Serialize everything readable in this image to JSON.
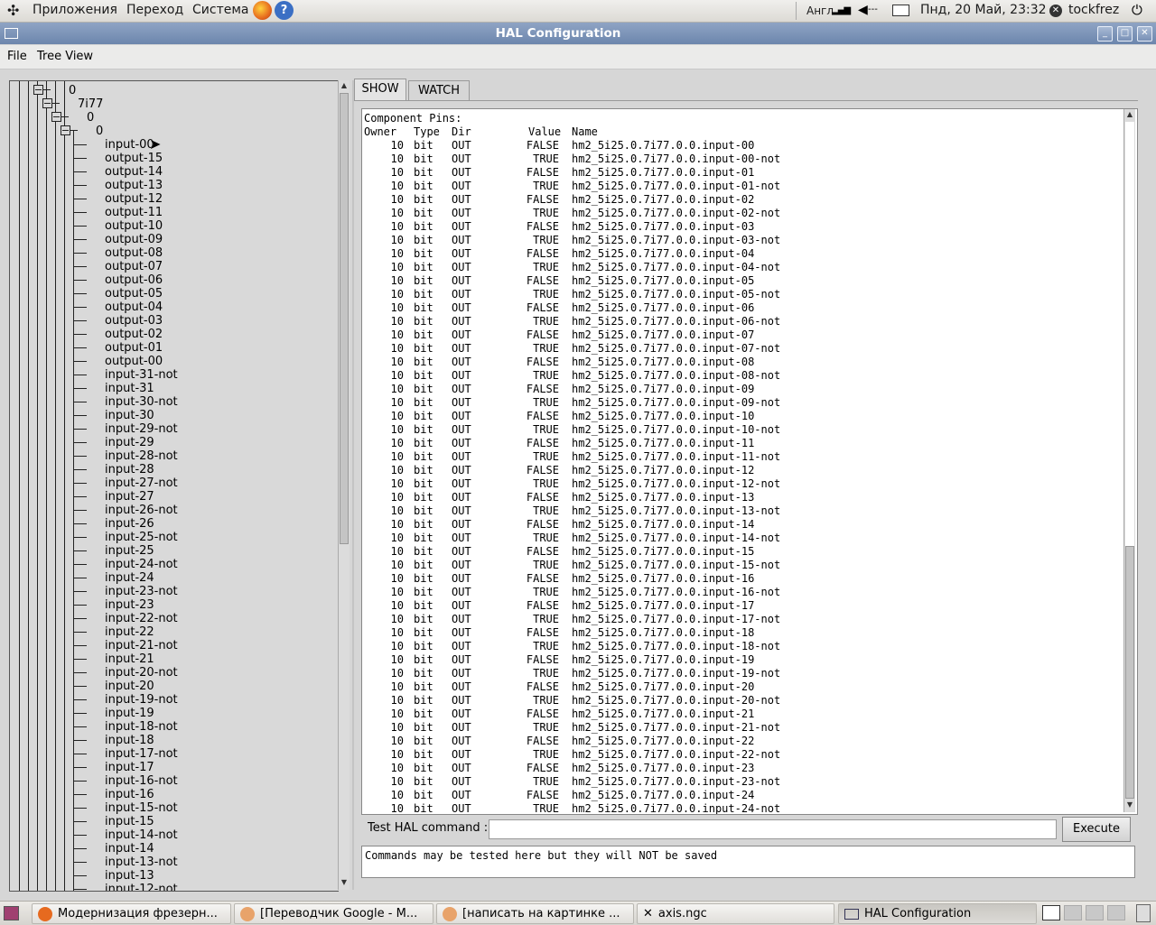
{
  "top_panel": {
    "applications": "Приложения",
    "places": "Переход",
    "system": "Система",
    "keyboard_layout": "Англ",
    "datetime": "Пнд, 20 Май, 23:32",
    "user": "tockfrez"
  },
  "window": {
    "title": "HAL Configuration"
  },
  "menubar": {
    "file": "File",
    "tree_view": "Tree View"
  },
  "tree": {
    "root_node": "0",
    "card_node": "7i77",
    "sub_node": "0",
    "sub_sub_node": "0",
    "items": [
      "input-00",
      "output-15",
      "output-14",
      "output-13",
      "output-12",
      "output-11",
      "output-10",
      "output-09",
      "output-08",
      "output-07",
      "output-06",
      "output-05",
      "output-04",
      "output-03",
      "output-02",
      "output-01",
      "output-00",
      "input-31-not",
      "input-31",
      "input-30-not",
      "input-30",
      "input-29-not",
      "input-29",
      "input-28-not",
      "input-28",
      "input-27-not",
      "input-27",
      "input-26-not",
      "input-26",
      "input-25-not",
      "input-25",
      "input-24-not",
      "input-24",
      "input-23-not",
      "input-23",
      "input-22-not",
      "input-22",
      "input-21-not",
      "input-21",
      "input-20-not",
      "input-20",
      "input-19-not",
      "input-19",
      "input-18-not",
      "input-18",
      "input-17-not",
      "input-17",
      "input-16-not",
      "input-16",
      "input-15-not",
      "input-15",
      "input-14-not",
      "input-14",
      "input-13-not",
      "input-13",
      "input-12-not"
    ]
  },
  "tabs": {
    "show": "SHOW",
    "watch": "WATCH"
  },
  "show": {
    "heading": "Component Pins:",
    "columns": [
      "Owner",
      "Type",
      "Dir",
      "Value",
      "Name"
    ],
    "rows": [
      [
        "10",
        "bit",
        "OUT",
        "FALSE",
        "hm2_5i25.0.7i77.0.0.input-00"
      ],
      [
        "10",
        "bit",
        "OUT",
        "TRUE",
        "hm2_5i25.0.7i77.0.0.input-00-not"
      ],
      [
        "10",
        "bit",
        "OUT",
        "FALSE",
        "hm2_5i25.0.7i77.0.0.input-01"
      ],
      [
        "10",
        "bit",
        "OUT",
        "TRUE",
        "hm2_5i25.0.7i77.0.0.input-01-not"
      ],
      [
        "10",
        "bit",
        "OUT",
        "FALSE",
        "hm2_5i25.0.7i77.0.0.input-02"
      ],
      [
        "10",
        "bit",
        "OUT",
        "TRUE",
        "hm2_5i25.0.7i77.0.0.input-02-not"
      ],
      [
        "10",
        "bit",
        "OUT",
        "FALSE",
        "hm2_5i25.0.7i77.0.0.input-03"
      ],
      [
        "10",
        "bit",
        "OUT",
        "TRUE",
        "hm2_5i25.0.7i77.0.0.input-03-not"
      ],
      [
        "10",
        "bit",
        "OUT",
        "FALSE",
        "hm2_5i25.0.7i77.0.0.input-04"
      ],
      [
        "10",
        "bit",
        "OUT",
        "TRUE",
        "hm2_5i25.0.7i77.0.0.input-04-not"
      ],
      [
        "10",
        "bit",
        "OUT",
        "FALSE",
        "hm2_5i25.0.7i77.0.0.input-05"
      ],
      [
        "10",
        "bit",
        "OUT",
        "TRUE",
        "hm2_5i25.0.7i77.0.0.input-05-not"
      ],
      [
        "10",
        "bit",
        "OUT",
        "FALSE",
        "hm2_5i25.0.7i77.0.0.input-06"
      ],
      [
        "10",
        "bit",
        "OUT",
        "TRUE",
        "hm2_5i25.0.7i77.0.0.input-06-not"
      ],
      [
        "10",
        "bit",
        "OUT",
        "FALSE",
        "hm2_5i25.0.7i77.0.0.input-07"
      ],
      [
        "10",
        "bit",
        "OUT",
        "TRUE",
        "hm2_5i25.0.7i77.0.0.input-07-not"
      ],
      [
        "10",
        "bit",
        "OUT",
        "FALSE",
        "hm2_5i25.0.7i77.0.0.input-08"
      ],
      [
        "10",
        "bit",
        "OUT",
        "TRUE",
        "hm2_5i25.0.7i77.0.0.input-08-not"
      ],
      [
        "10",
        "bit",
        "OUT",
        "FALSE",
        "hm2_5i25.0.7i77.0.0.input-09"
      ],
      [
        "10",
        "bit",
        "OUT",
        "TRUE",
        "hm2_5i25.0.7i77.0.0.input-09-not"
      ],
      [
        "10",
        "bit",
        "OUT",
        "FALSE",
        "hm2_5i25.0.7i77.0.0.input-10"
      ],
      [
        "10",
        "bit",
        "OUT",
        "TRUE",
        "hm2_5i25.0.7i77.0.0.input-10-not"
      ],
      [
        "10",
        "bit",
        "OUT",
        "FALSE",
        "hm2_5i25.0.7i77.0.0.input-11"
      ],
      [
        "10",
        "bit",
        "OUT",
        "TRUE",
        "hm2_5i25.0.7i77.0.0.input-11-not"
      ],
      [
        "10",
        "bit",
        "OUT",
        "FALSE",
        "hm2_5i25.0.7i77.0.0.input-12"
      ],
      [
        "10",
        "bit",
        "OUT",
        "TRUE",
        "hm2_5i25.0.7i77.0.0.input-12-not"
      ],
      [
        "10",
        "bit",
        "OUT",
        "FALSE",
        "hm2_5i25.0.7i77.0.0.input-13"
      ],
      [
        "10",
        "bit",
        "OUT",
        "TRUE",
        "hm2_5i25.0.7i77.0.0.input-13-not"
      ],
      [
        "10",
        "bit",
        "OUT",
        "FALSE",
        "hm2_5i25.0.7i77.0.0.input-14"
      ],
      [
        "10",
        "bit",
        "OUT",
        "TRUE",
        "hm2_5i25.0.7i77.0.0.input-14-not"
      ],
      [
        "10",
        "bit",
        "OUT",
        "FALSE",
        "hm2_5i25.0.7i77.0.0.input-15"
      ],
      [
        "10",
        "bit",
        "OUT",
        "TRUE",
        "hm2_5i25.0.7i77.0.0.input-15-not"
      ],
      [
        "10",
        "bit",
        "OUT",
        "FALSE",
        "hm2_5i25.0.7i77.0.0.input-16"
      ],
      [
        "10",
        "bit",
        "OUT",
        "TRUE",
        "hm2_5i25.0.7i77.0.0.input-16-not"
      ],
      [
        "10",
        "bit",
        "OUT",
        "FALSE",
        "hm2_5i25.0.7i77.0.0.input-17"
      ],
      [
        "10",
        "bit",
        "OUT",
        "TRUE",
        "hm2_5i25.0.7i77.0.0.input-17-not"
      ],
      [
        "10",
        "bit",
        "OUT",
        "FALSE",
        "hm2_5i25.0.7i77.0.0.input-18"
      ],
      [
        "10",
        "bit",
        "OUT",
        "TRUE",
        "hm2_5i25.0.7i77.0.0.input-18-not"
      ],
      [
        "10",
        "bit",
        "OUT",
        "FALSE",
        "hm2_5i25.0.7i77.0.0.input-19"
      ],
      [
        "10",
        "bit",
        "OUT",
        "TRUE",
        "hm2_5i25.0.7i77.0.0.input-19-not"
      ],
      [
        "10",
        "bit",
        "OUT",
        "FALSE",
        "hm2_5i25.0.7i77.0.0.input-20"
      ],
      [
        "10",
        "bit",
        "OUT",
        "TRUE",
        "hm2_5i25.0.7i77.0.0.input-20-not"
      ],
      [
        "10",
        "bit",
        "OUT",
        "FALSE",
        "hm2_5i25.0.7i77.0.0.input-21"
      ],
      [
        "10",
        "bit",
        "OUT",
        "TRUE",
        "hm2_5i25.0.7i77.0.0.input-21-not"
      ],
      [
        "10",
        "bit",
        "OUT",
        "FALSE",
        "hm2_5i25.0.7i77.0.0.input-22"
      ],
      [
        "10",
        "bit",
        "OUT",
        "TRUE",
        "hm2_5i25.0.7i77.0.0.input-22-not"
      ],
      [
        "10",
        "bit",
        "OUT",
        "FALSE",
        "hm2_5i25.0.7i77.0.0.input-23"
      ],
      [
        "10",
        "bit",
        "OUT",
        "TRUE",
        "hm2_5i25.0.7i77.0.0.input-23-not"
      ],
      [
        "10",
        "bit",
        "OUT",
        "FALSE",
        "hm2_5i25.0.7i77.0.0.input-24"
      ],
      [
        "10",
        "bit",
        "OUT",
        "TRUE",
        "hm2_5i25.0.7i77.0.0.input-24-not"
      ]
    ]
  },
  "command": {
    "label": "Test HAL command :",
    "value": "",
    "execute_label": "Execute",
    "output_text": "Commands may be tested here but they will NOT be saved"
  },
  "taskbar": {
    "tasks": [
      "Модернизация фрезерн...",
      "[Переводчик Google - М...",
      "[написать на картинке ...",
      "axis.ngc",
      "HAL Configuration"
    ]
  },
  "colors": {
    "titlebar": "#7a92b8",
    "firefox": "#e66a1f",
    "help": "#3b6fc4"
  }
}
